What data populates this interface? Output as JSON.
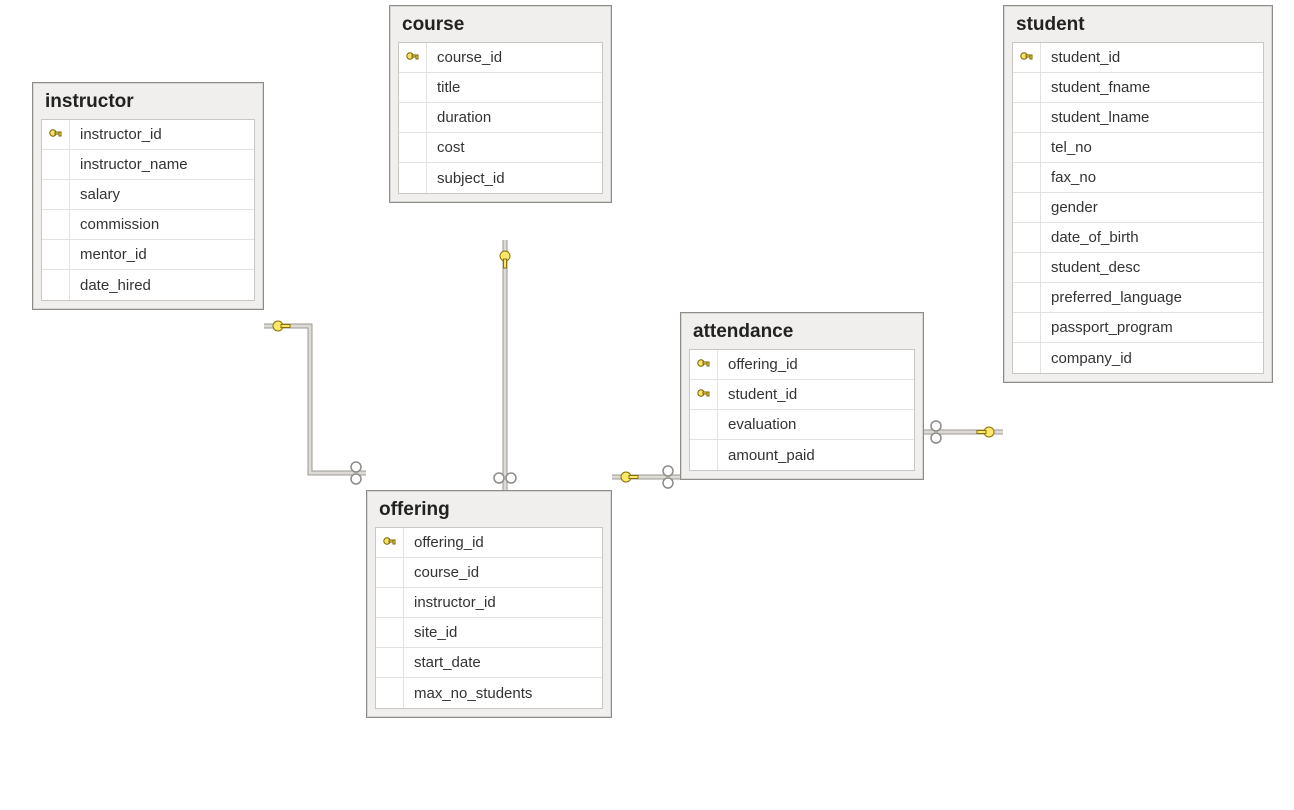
{
  "entities": {
    "instructor": {
      "title": "instructor",
      "columns": [
        {
          "name": "instructor_id",
          "pk": true
        },
        {
          "name": "instructor_name",
          "pk": false
        },
        {
          "name": "salary",
          "pk": false
        },
        {
          "name": "commission",
          "pk": false
        },
        {
          "name": "mentor_id",
          "pk": false
        },
        {
          "name": "date_hired",
          "pk": false
        }
      ]
    },
    "course": {
      "title": "course",
      "columns": [
        {
          "name": "course_id",
          "pk": true
        },
        {
          "name": "title",
          "pk": false
        },
        {
          "name": "duration",
          "pk": false
        },
        {
          "name": "cost",
          "pk": false
        },
        {
          "name": "subject_id",
          "pk": false
        }
      ]
    },
    "offering": {
      "title": "offering",
      "columns": [
        {
          "name": "offering_id",
          "pk": true
        },
        {
          "name": "course_id",
          "pk": false
        },
        {
          "name": "instructor_id",
          "pk": false
        },
        {
          "name": "site_id",
          "pk": false
        },
        {
          "name": "start_date",
          "pk": false
        },
        {
          "name": "max_no_students",
          "pk": false
        }
      ]
    },
    "attendance": {
      "title": "attendance",
      "columns": [
        {
          "name": "offering_id",
          "pk": true
        },
        {
          "name": "student_id",
          "pk": true
        },
        {
          "name": "evaluation",
          "pk": false
        },
        {
          "name": "amount_paid",
          "pk": false
        }
      ]
    },
    "student": {
      "title": "student",
      "columns": [
        {
          "name": "student_id",
          "pk": true
        },
        {
          "name": "student_fname",
          "pk": false
        },
        {
          "name": "student_lname",
          "pk": false
        },
        {
          "name": "tel_no",
          "pk": false
        },
        {
          "name": "fax_no",
          "pk": false
        },
        {
          "name": "gender",
          "pk": false
        },
        {
          "name": "date_of_birth",
          "pk": false
        },
        {
          "name": "student_desc",
          "pk": false
        },
        {
          "name": "preferred_language",
          "pk": false
        },
        {
          "name": "passport_program",
          "pk": false
        },
        {
          "name": "company_id",
          "pk": false
        }
      ]
    }
  },
  "relationships": [
    {
      "from": "instructor",
      "to": "offering",
      "from_card": "one",
      "to_card": "many"
    },
    {
      "from": "course",
      "to": "offering",
      "from_card": "one",
      "to_card": "many"
    },
    {
      "from": "offering",
      "to": "attendance",
      "from_card": "one",
      "to_card": "many"
    },
    {
      "from": "student",
      "to": "attendance",
      "from_card": "one",
      "to_card": "many"
    }
  ]
}
